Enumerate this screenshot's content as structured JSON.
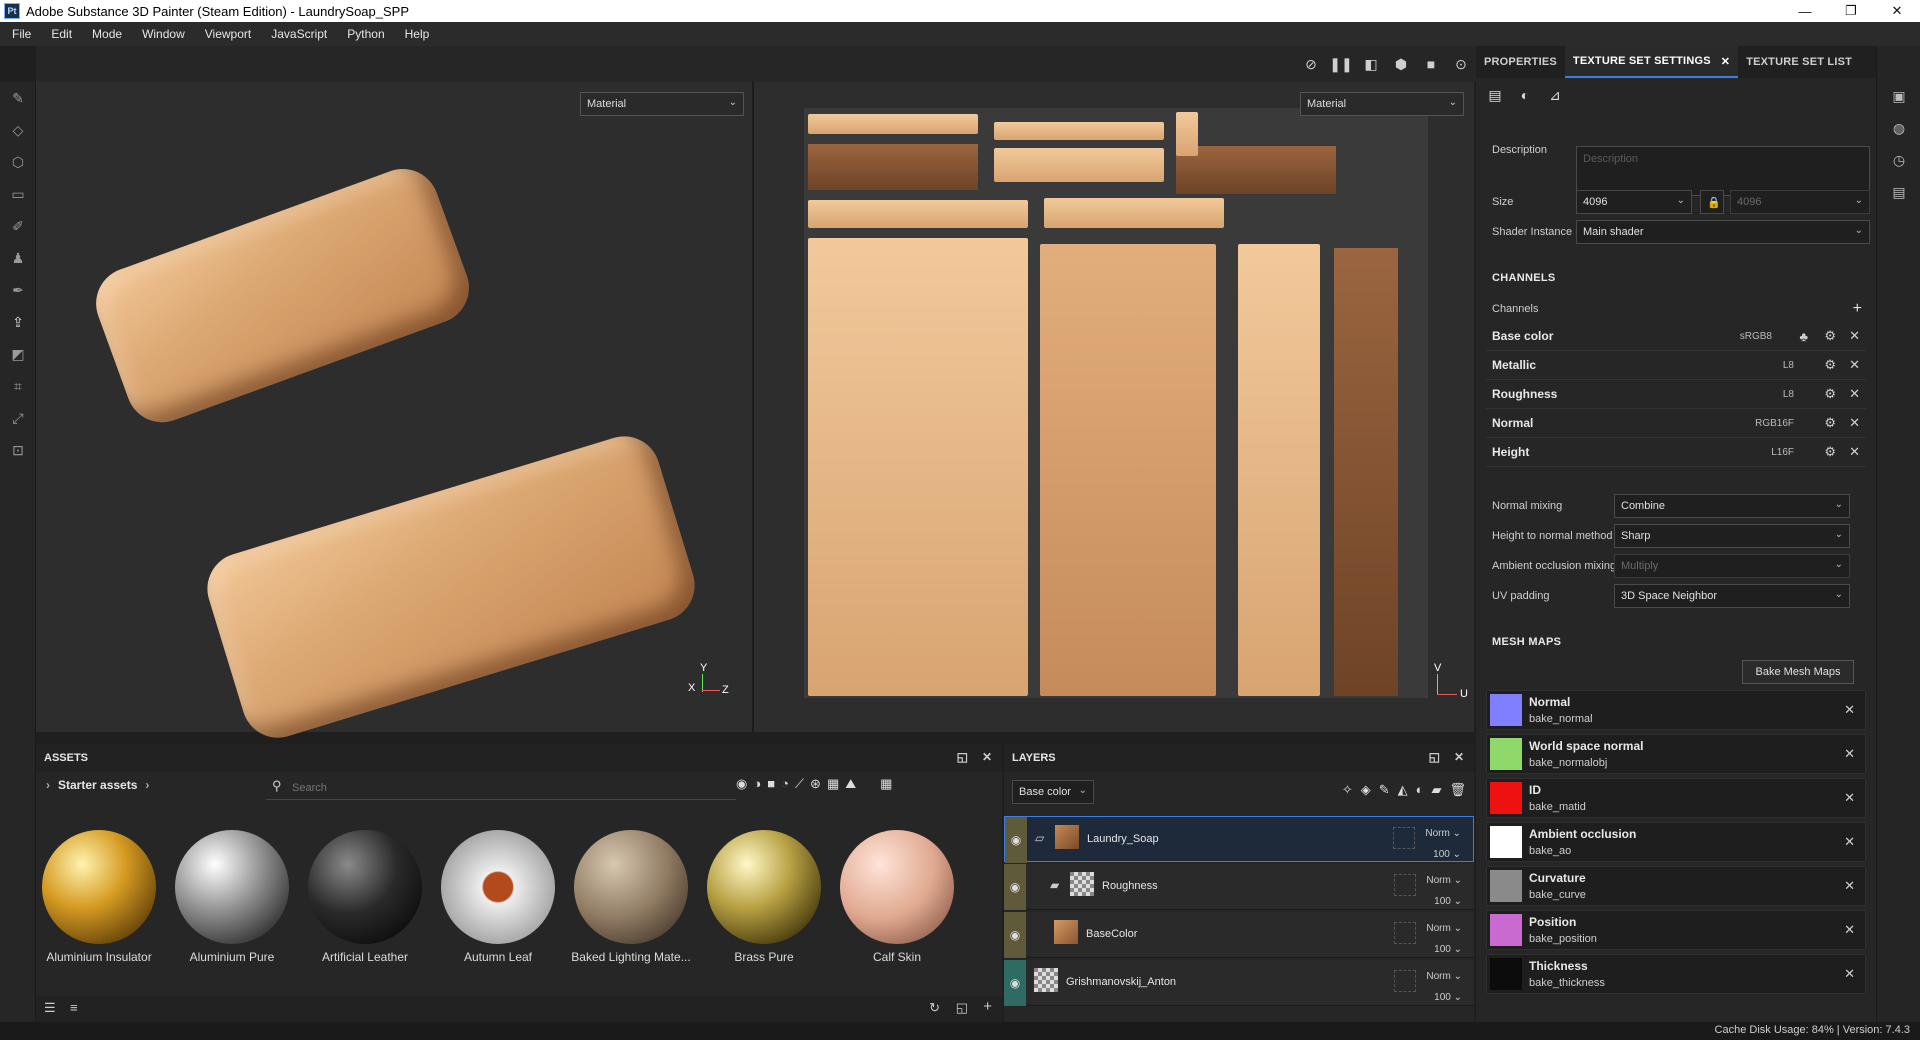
{
  "titlebar": {
    "title": "Adobe Substance 3D Painter (Steam Edition) - LaundrySoap_SPP",
    "app_icon_text": "Pt",
    "minimize": "—",
    "maximize": "❐",
    "close": "✕"
  },
  "menu": [
    "File",
    "Edit",
    "Mode",
    "Window",
    "Viewport",
    "JavaScript",
    "Python",
    "Help"
  ],
  "viewport3d": {
    "material_mode": "Material",
    "axis_x": "X",
    "axis_y": "Y",
    "axis_z": "Z"
  },
  "viewport2d": {
    "material_mode": "Material",
    "axis_v": "V",
    "axis_u": "U"
  },
  "right_tabs": {
    "properties": "PROPERTIES",
    "texture_set_settings": "TEXTURE SET SETTINGS",
    "texture_set_list": "TEXTURE SET LIST",
    "close": "✕"
  },
  "texture_set": {
    "description_label": "Description",
    "description_placeholder": "Description",
    "size_label": "Size",
    "size_value": "4096",
    "size_value_locked": "4096",
    "shader_label": "Shader Instance",
    "shader_value": "Main shader"
  },
  "channels": {
    "section": "CHANNELS",
    "label": "Channels",
    "add": "+",
    "items": [
      {
        "name": "Base color",
        "format": "sRGB8"
      },
      {
        "name": "Metallic",
        "format": "L8"
      },
      {
        "name": "Roughness",
        "format": "L8"
      },
      {
        "name": "Normal",
        "format": "RGB16F"
      },
      {
        "name": "Height",
        "format": "L16F"
      }
    ]
  },
  "options": {
    "normal_mixing_label": "Normal mixing",
    "normal_mixing_value": "Combine",
    "height_to_normal_label": "Height to normal method",
    "height_to_normal_value": "Sharp",
    "ao_mixing_label": "Ambient occlusion mixing",
    "ao_mixing_value": "Multiply",
    "uv_padding_label": "UV padding",
    "uv_padding_value": "3D Space Neighbor"
  },
  "mesh_maps": {
    "section": "MESH MAPS",
    "bake_button": "Bake Mesh Maps",
    "items": [
      {
        "name": "Normal",
        "map": "bake_normal",
        "color": "#7f7fff"
      },
      {
        "name": "World space normal",
        "map": "bake_normalobj",
        "color": "#8fd96a"
      },
      {
        "name": "ID",
        "map": "bake_matid",
        "color": "#ee1111"
      },
      {
        "name": "Ambient occlusion",
        "map": "bake_ao",
        "color": "#ffffff"
      },
      {
        "name": "Curvature",
        "map": "bake_curve",
        "color": "#8a8a8a"
      },
      {
        "name": "Position",
        "map": "bake_position",
        "color": "#c86ad0"
      },
      {
        "name": "Thickness",
        "map": "bake_thickness",
        "color": "#0c0c0c"
      }
    ]
  },
  "assets": {
    "title": "ASSETS",
    "breadcrumb": "Starter assets",
    "search_placeholder": "Search",
    "items": [
      {
        "name": "Aluminium Insulator"
      },
      {
        "name": "Aluminium Pure"
      },
      {
        "name": "Artificial Leather"
      },
      {
        "name": "Autumn Leaf"
      },
      {
        "name": "Baked Lighting Mate..."
      },
      {
        "name": "Brass Pure"
      },
      {
        "name": "Calf Skin"
      }
    ]
  },
  "layers": {
    "title": "LAYERS",
    "channel_select": "Base color",
    "items": [
      {
        "name": "Laundry_Soap",
        "blend": "Norm",
        "opacity": "100"
      },
      {
        "name": "Roughness",
        "blend": "Norm",
        "opacity": "100"
      },
      {
        "name": "BaseColor",
        "blend": "Norm",
        "opacity": "100"
      },
      {
        "name": "Grishmanovskij_Anton",
        "blend": "Norm",
        "opacity": "100"
      }
    ]
  },
  "status": {
    "text": "Cache Disk Usage:   84% | Version: 7.4.3"
  }
}
